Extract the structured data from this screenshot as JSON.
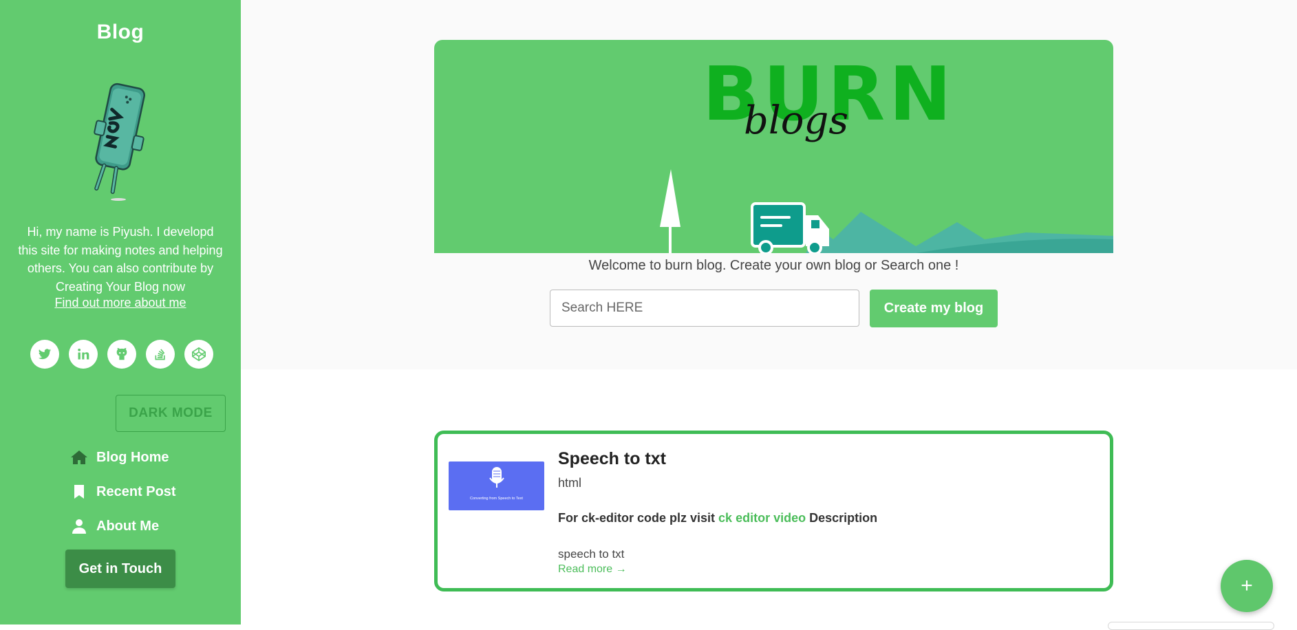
{
  "sidebar": {
    "brand": "Blog",
    "bio": "Hi, my name is Piyush. I developd this site for making notes and helping others. You can also contribute by Creating Your Blog now",
    "bio_link": "Find out more about me",
    "socials": [
      "twitter-icon",
      "linkedin-icon",
      "github-icon",
      "stackoverflow-icon",
      "codepen-icon"
    ],
    "dark_mode_label": "DARK MODE",
    "nav": [
      {
        "label": "Blog Home",
        "icon": "home-icon"
      },
      {
        "label": "Recent Post",
        "icon": "bookmark-icon"
      },
      {
        "label": "About Me",
        "icon": "user-icon"
      }
    ],
    "touch_label": "Get in Touch"
  },
  "hero": {
    "banner_logo_top": "BURN",
    "banner_logo_script": "blogs",
    "welcome": "Welcome to burn blog. Create your own blog or Search one !",
    "search_placeholder": "Search HERE",
    "create_label": "Create my blog"
  },
  "post": {
    "title": "Speech to txt",
    "tag": "html",
    "desc_prefix": "For ck-editor code plz visit ",
    "desc_link": "ck editor video",
    "desc_suffix": " Description",
    "excerpt": "speech to txt",
    "read_more": "Read more →",
    "thumb_caption": "Converting from Speech to Text"
  },
  "fab_label": "+",
  "colors": {
    "primary": "#62cb6f",
    "dark_green": "#3c8d47",
    "card_border": "#3fbc55",
    "thumb": "#5b6ef2"
  }
}
